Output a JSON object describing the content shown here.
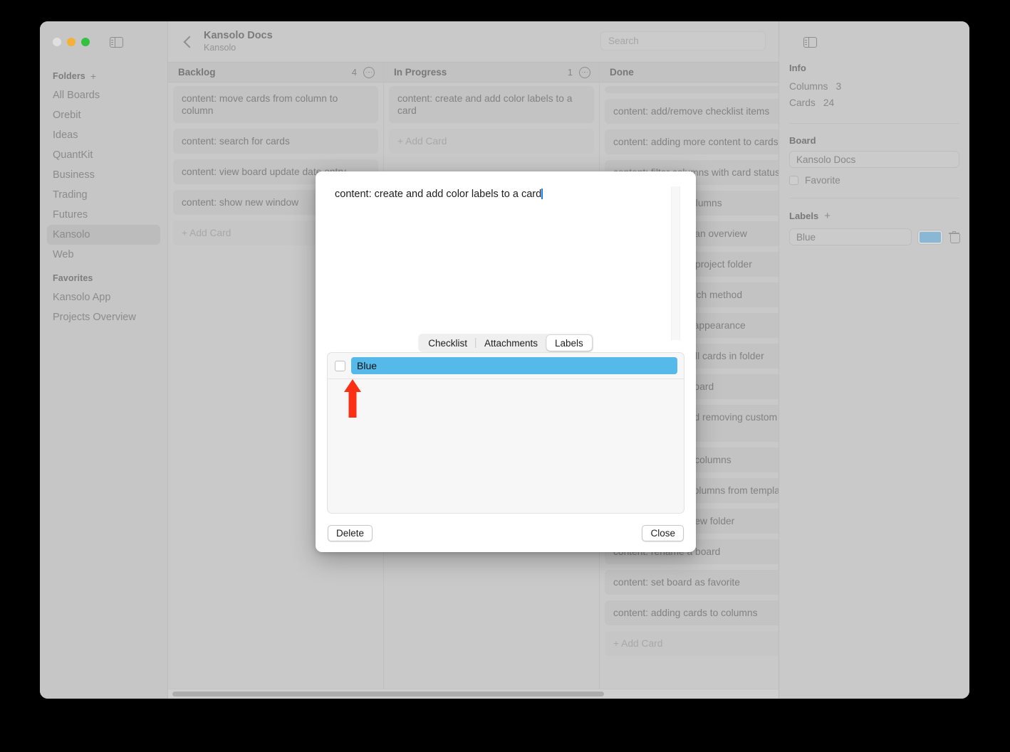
{
  "window": {
    "traffic_lights": [
      "close",
      "minimize",
      "maximize"
    ],
    "sidebar_toggle_icon": "sidebar-toggle-icon"
  },
  "sidebar": {
    "folders_header": "Folders",
    "folders_add": "+",
    "folders": [
      {
        "label": "All Boards",
        "active": false
      },
      {
        "label": "Orebit",
        "active": false
      },
      {
        "label": "Ideas",
        "active": false
      },
      {
        "label": "QuantKit",
        "active": false
      },
      {
        "label": "Business",
        "active": false
      },
      {
        "label": "Trading",
        "active": false
      },
      {
        "label": "Futures",
        "active": false
      },
      {
        "label": "Kansolo",
        "active": true
      },
      {
        "label": "Web",
        "active": false
      }
    ],
    "favorites_header": "Favorites",
    "favorites": [
      {
        "label": "Kansolo App"
      },
      {
        "label": "Projects Overview"
      }
    ]
  },
  "topbar": {
    "back_icon": "back-chevron-icon",
    "title": "Kansolo Docs",
    "subtitle": "Kansolo",
    "search_placeholder": "Search",
    "search_value": ""
  },
  "board": {
    "columns": [
      {
        "name": "Backlog",
        "count": "4",
        "menu_icon": "ellipsis-circle-icon",
        "cards": [
          "content: move cards from column to column",
          "content: search for cards",
          "content: view board update date entry",
          "content: show new window"
        ],
        "add_card_label": "+ Add Card"
      },
      {
        "name": "In Progress",
        "count": "1",
        "menu_icon": "ellipsis-circle-icon",
        "cards": [
          "content: create and add color labels to a card"
        ],
        "add_card_label": "+ Add Card"
      },
      {
        "name": "Done",
        "count": "",
        "menu_icon": "ellipsis-circle-icon",
        "cards": [
          "content: add/remove checklist items",
          "content: adding more content to cards",
          "content: filter columns with card status",
          "content: reorder columns",
          "content: view kanban overview",
          "content: rename a project folder",
          "content: using search method",
          "content: changing appearance",
          "content: showing all cards in folder",
          "content: delete a board",
          "content: adding and removing custom columns in board",
          "content: renaming columns",
          "content: creating columns from template",
          "content: create a new folder",
          "content: rename a board",
          "content: set board as favorite",
          "content: adding cards to columns"
        ],
        "add_card_label": "+ Add Card"
      }
    ]
  },
  "inspector": {
    "toggle_icon": "inspector-toggle-icon",
    "info_header": "Info",
    "info_rows": [
      {
        "key": "Columns",
        "value": "3"
      },
      {
        "key": "Cards",
        "value": "24"
      }
    ],
    "board_header": "Board",
    "board_name_value": "Kansolo Docs",
    "favorite_label": "Favorite",
    "favorite_checked": false,
    "labels_header": "Labels",
    "labels_add": "+",
    "labels": [
      {
        "name": "Blue",
        "color": "#8ab8d4",
        "delete_icon": "trash-icon"
      }
    ]
  },
  "modal": {
    "card_text": "content: create and add color labels to a card",
    "tabs": [
      {
        "label": "Checklist",
        "active": false
      },
      {
        "label": "Attachments",
        "active": false
      },
      {
        "label": "Labels",
        "active": true
      }
    ],
    "label_items": [
      {
        "name": "Blue",
        "checked": false,
        "color": "#55b9ea"
      }
    ],
    "annotation_arrow": "red-up-arrow-annotation",
    "delete_label": "Delete",
    "close_label": "Close"
  },
  "colors": {
    "accent_blue": "#55b9ea",
    "label_swatch": "#8ab8d4",
    "caret": "#1a7ef0",
    "annotation_red": "#fa2f14"
  }
}
